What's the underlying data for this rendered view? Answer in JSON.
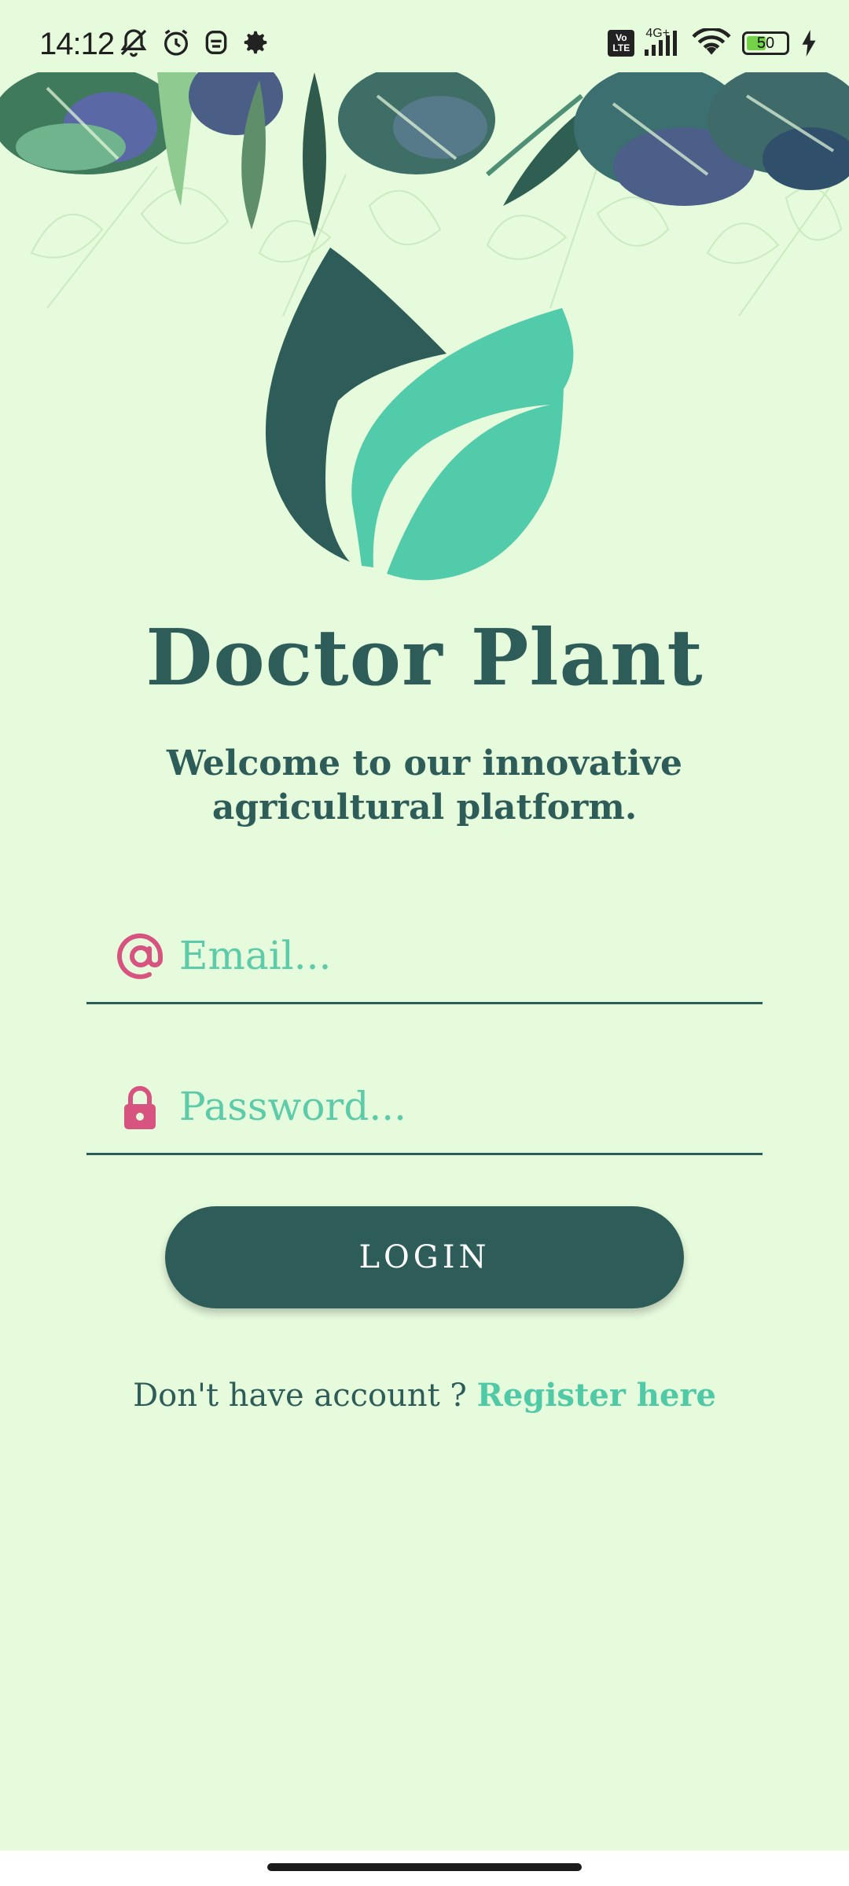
{
  "status_bar": {
    "time": "14:12",
    "left_icons": [
      "bell-off-icon",
      "alarm-icon",
      "robot-icon",
      "gear-icon"
    ],
    "lte_label_top": "Vo",
    "lte_label_bottom": "LTE",
    "network_type": "4G+",
    "battery_level": "50",
    "battery_fraction": 0.5
  },
  "app": {
    "title": "Doctor Plant",
    "welcome": "Welcome to our innovative agricultural platform."
  },
  "form": {
    "email_placeholder": "Email...",
    "email_value": "",
    "password_placeholder": "Password...",
    "password_value": "",
    "login_label": "LOGIN"
  },
  "register": {
    "prompt": "Don't have account ?",
    "link_label": "Register here"
  },
  "colors": {
    "background": "#e6fadc",
    "primary": "#2e5d59",
    "accent": "#4fc9a6",
    "icon_pink": "#d6547f"
  }
}
